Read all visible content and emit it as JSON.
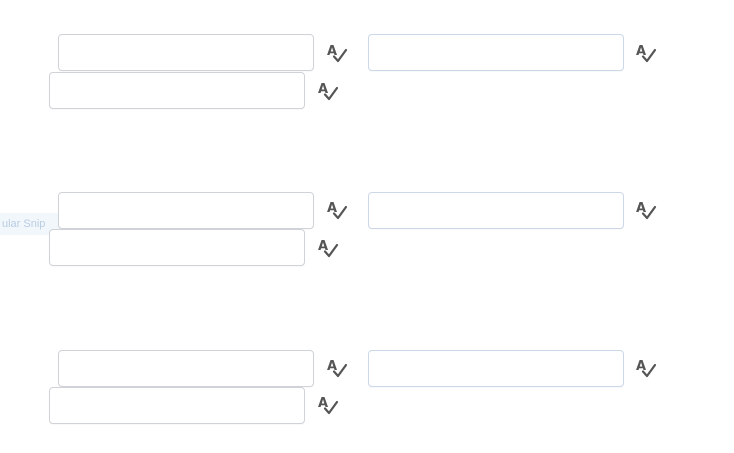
{
  "background_color": "#ffffff",
  "field_border_color": "#cfd3d8",
  "icon_name": "spellcheck-icon",
  "ghost_tag": {
    "label": "ular Snip"
  },
  "groups": [
    {
      "fields": [
        {
          "value": "",
          "placeholder": ""
        },
        {
          "value": "",
          "placeholder": ""
        },
        {
          "value": "",
          "placeholder": ""
        }
      ]
    },
    {
      "fields": [
        {
          "value": "",
          "placeholder": ""
        },
        {
          "value": "",
          "placeholder": ""
        },
        {
          "value": "",
          "placeholder": ""
        }
      ]
    },
    {
      "fields": [
        {
          "value": "",
          "placeholder": ""
        },
        {
          "value": "",
          "placeholder": ""
        },
        {
          "value": "",
          "placeholder": ""
        }
      ]
    }
  ]
}
